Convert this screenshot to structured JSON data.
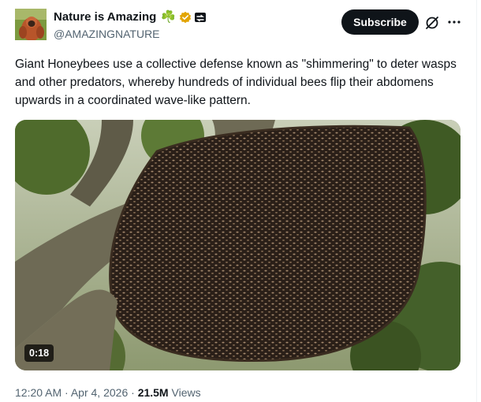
{
  "author": {
    "display_name": "Nature is Amazing",
    "emoji": "☘️",
    "handle": "@AMAZINGNATURE",
    "verified_color": "#e2a400",
    "avatar_icon": "orangutan-avatar"
  },
  "actions": {
    "subscribe_label": "Subscribe",
    "grok_icon": "grok-icon",
    "more_icon": "more-icon"
  },
  "tweet": {
    "text": "Giant Honeybees use a collective defense known as \"shimmering\" to deter wasps and other predators, whereby hundreds of individual bees flip their abdomens upwards in a coordinated wave-like pattern."
  },
  "media": {
    "duration": "0:18",
    "description_icon": "video-thumbnail"
  },
  "meta": {
    "time": "12:20 AM",
    "separator": "·",
    "date": "Apr 4, 2026",
    "views_count": "21.5M",
    "views_label": "Views"
  },
  "colors": {
    "text_primary": "#0f1419",
    "text_secondary": "#536471",
    "subscribe_bg": "#0f1419"
  }
}
